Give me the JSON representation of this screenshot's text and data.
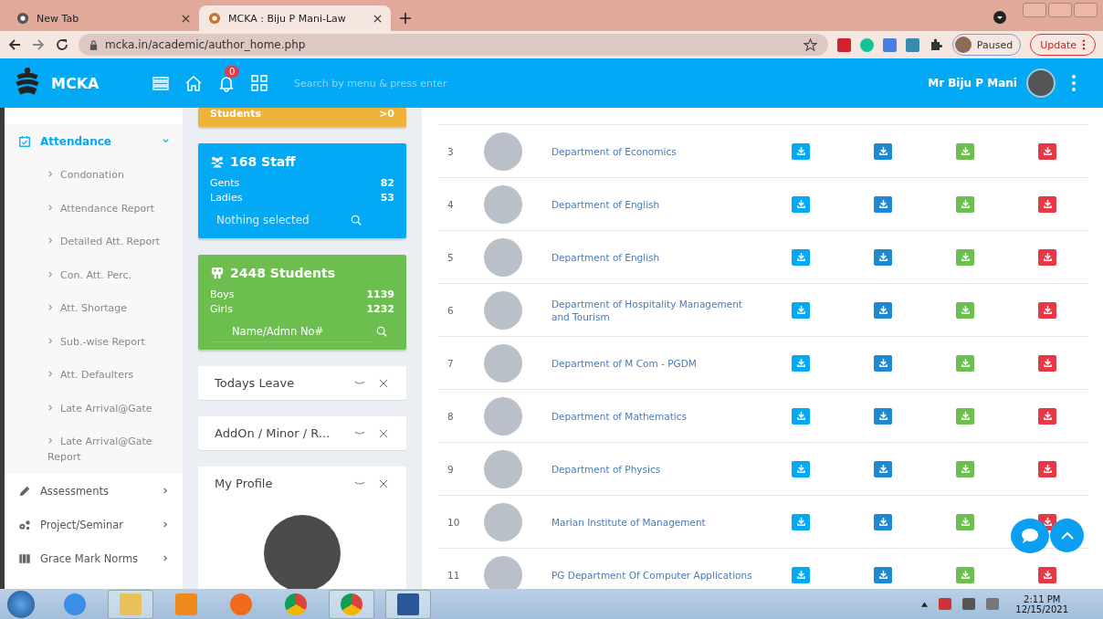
{
  "browser": {
    "tabs": [
      {
        "title": "New Tab",
        "selected": false
      },
      {
        "title": "MCKA : Biju P Mani-Law",
        "selected": true
      }
    ],
    "url": "mcka.in/academic/author_home.php",
    "profile_label": "Paused",
    "update_label": "Update"
  },
  "header": {
    "brand": "MCKA",
    "notification_count": "0",
    "search_placeholder": "Search by menu & press enter",
    "user_name": "Mr Biju P Mani"
  },
  "sidebar": {
    "items": [
      {
        "label": "Attendance",
        "expanded": true,
        "selected": true,
        "children": [
          {
            "label": "Condonation"
          },
          {
            "label": "Attendance Report"
          },
          {
            "label": "Detailed Att. Report"
          },
          {
            "label": "Con. Att. Perc."
          },
          {
            "label": "Att. Shortage"
          },
          {
            "label": "Sub.-wise Report"
          },
          {
            "label": "Att. Defaulters"
          },
          {
            "label": "Late Arrival@Gate"
          },
          {
            "label": "Late Arrival@Gate Report"
          }
        ]
      },
      {
        "label": "Assessments",
        "expanded": false,
        "selected": false
      },
      {
        "label": "Project/Seminar",
        "expanded": false,
        "selected": false
      },
      {
        "label": "Grace Mark Norms",
        "expanded": false,
        "selected": false
      }
    ]
  },
  "summary_card": {
    "label": "Students",
    "value": ">0"
  },
  "staff_card": {
    "title": "168 Staff",
    "rows": [
      {
        "label": "Gents",
        "value": "82"
      },
      {
        "label": "Ladies",
        "value": "53"
      }
    ],
    "select_placeholder": "Nothing selected"
  },
  "students_card": {
    "title": "2448 Students",
    "rows": [
      {
        "label": "Boys",
        "value": "1139"
      },
      {
        "label": "Girls",
        "value": "1232"
      }
    ],
    "search_placeholder": "Name/Admn No#"
  },
  "widgets": [
    {
      "title": "Todays Leave",
      "kind": "collapsed"
    },
    {
      "title": "AddOn / Minor / R...",
      "kind": "collapsed"
    },
    {
      "title": "My Profile",
      "kind": "profile"
    }
  ],
  "table": {
    "action_buttons": [
      {
        "color": "#03a9f4"
      },
      {
        "color": "#1e88d0"
      },
      {
        "color": "#6cbf4f"
      },
      {
        "color": "#e53945"
      }
    ],
    "rows": [
      {
        "number": "3",
        "department": "Department of Economics"
      },
      {
        "number": "4",
        "department": "Department of English"
      },
      {
        "number": "5",
        "department": "Department of English"
      },
      {
        "number": "6",
        "department": "Department of Hospitality Management and Tourism"
      },
      {
        "number": "7",
        "department": "Department of M Com - PGDM"
      },
      {
        "number": "8",
        "department": "Department of Mathematics"
      },
      {
        "number": "9",
        "department": "Department of Physics"
      },
      {
        "number": "10",
        "department": "Marian Institute of Management"
      },
      {
        "number": "11",
        "department": "PG Department Of Computer Applications"
      }
    ]
  },
  "taskbar": {
    "time": "2:11 PM",
    "date": "12/15/2021"
  }
}
